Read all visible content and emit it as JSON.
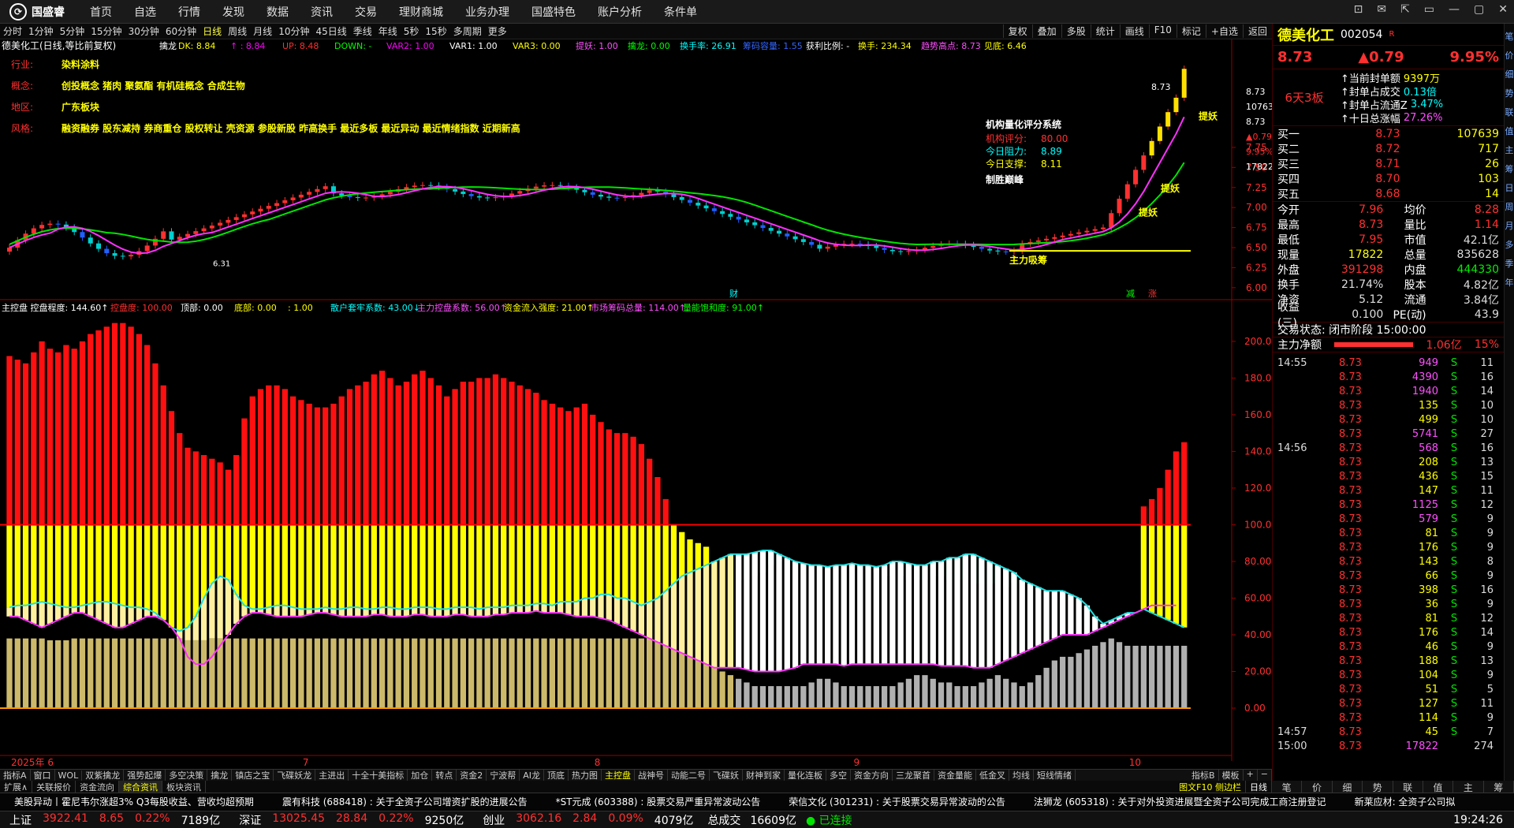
{
  "app": {
    "logo": "国盛睿",
    "menu": [
      "首页",
      "自选",
      "行情",
      "发现",
      "数据",
      "资讯",
      "交易",
      "理财商城",
      "业务办理",
      "国盛特色",
      "账户分析",
      "条件单"
    ],
    "window_controls": [
      "⊡",
      "✉",
      "⇱",
      "▭",
      "—",
      "▢",
      "✕"
    ]
  },
  "toolbar": {
    "periods": [
      "分时",
      "1分钟",
      "5分钟",
      "15分钟",
      "30分钟",
      "60分钟",
      "日线",
      "周线",
      "月线",
      "10分钟",
      "45日线",
      "季线",
      "年线",
      "5秒",
      "15秒",
      "多周期",
      "更多"
    ],
    "active_period": "日线",
    "right": [
      "复权",
      "叠加",
      "多股",
      "统计",
      "画线",
      "F10",
      "标记",
      "+自选",
      "返回"
    ]
  },
  "kline": {
    "title": "德美化工(日线,等比前复权)",
    "indicator_line": [
      {
        "t": "擒龙",
        "c": "#fff"
      },
      {
        "t": "DK: 8.84",
        "c": "#ff0"
      },
      {
        "t": "↑ : 8.84",
        "c": "#f0f"
      },
      {
        "t": "UP: 8.48",
        "c": "#ff3030"
      },
      {
        "t": "DOWN:  -",
        "c": "#0f0"
      },
      {
        "t": "VAR2: 1.00",
        "c": "#f0f"
      },
      {
        "t": "VAR1: 1.00",
        "c": "#fff"
      },
      {
        "t": "VAR3: 0.00",
        "c": "#ff0"
      },
      {
        "t": "提妖: 1.00",
        "c": "#ff50ff"
      },
      {
        "t": "擒龙: 0.00",
        "c": "#0f0"
      },
      {
        "t": "换手率: 26.91",
        "c": "#0ff"
      },
      {
        "t": "筹码容量: 1.55",
        "c": "#36f"
      },
      {
        "t": "获利比例:  -",
        "c": "#fff"
      },
      {
        "t": "换手: 234.34",
        "c": "#ff0"
      },
      {
        "t": "趋势高点: 8.73",
        "c": "#ff50ff"
      },
      {
        "t": "见底: 6.46",
        "c": "#ff0"
      }
    ],
    "info_rows": [
      {
        "label": "行业:",
        "value": "染料涂料"
      },
      {
        "label": "概念:",
        "value": "创投概念 猪肉 聚氨酯 有机硅概念 合成生物"
      },
      {
        "label": "地区:",
        "value": "广东板块"
      },
      {
        "label": "风格:",
        "value": "融资融券 股东减持 券商重仓 股权转让 壳资源 参股新股 昨高换手 最近多板 最近异动 最近情绪指数 近期新高"
      }
    ],
    "eval_box": {
      "title": "机构量化评分系统",
      "rows": [
        {
          "k": "机构评分:",
          "v": "80.00",
          "c": "#ff3030"
        },
        {
          "k": "今日阻力:",
          "v": "8.89",
          "c": "#0ff"
        },
        {
          "k": "今日支撑:",
          "v": "8.11",
          "c": "#ff0"
        }
      ],
      "footer": "制胜巅峰"
    },
    "labels": {
      "high": "8.73",
      "low": "6.31",
      "zljc": "主力吸筹",
      "ty1": "提妖",
      "ty2": "提妖",
      "ty3": "提妖",
      "cai": "财",
      "jian": "减",
      "zhang": "涨"
    },
    "right_axis_info": [
      "8.73",
      "107639",
      "8.73",
      "▲0.79",
      "9.95%",
      "17822"
    ],
    "y_ticks": [
      {
        "v": 7.75,
        "t": "7.75"
      },
      {
        "v": 7.5,
        "t": "7.50"
      },
      {
        "v": 7.25,
        "t": "7.25"
      },
      {
        "v": 7.0,
        "t": "7.00"
      },
      {
        "v": 6.75,
        "t": "6.75"
      },
      {
        "v": 6.5,
        "t": "6.50"
      },
      {
        "v": 6.25,
        "t": "6.25"
      },
      {
        "v": 6.0,
        "t": "6.00"
      }
    ]
  },
  "ind": {
    "title_line": [
      {
        "t": "主控盘  控盘程度: 144.60↑",
        "c": "#fff"
      },
      {
        "t": "控盘度: 100.00",
        "c": "#ff3030"
      },
      {
        "t": "顶部: 0.00",
        "c": "#fff"
      },
      {
        "t": "底部: 0.00",
        "c": "#ff0"
      },
      {
        "t": ": 1.00",
        "c": "#ff0"
      },
      {
        "t": "散户套牢系数: 43.00↓",
        "c": "#0ff"
      },
      {
        "t": "主力控盘系数: 56.00↑",
        "c": "#ff50ff"
      },
      {
        "t": "资金流入强度: 21.00↑",
        "c": "#ff0"
      },
      {
        "t": "市场筹码总量: 114.00↑",
        "c": "#ff50ff"
      },
      {
        "t": "量能饱和度: 91.00↑",
        "c": "#0f0"
      }
    ],
    "y_ticks": [
      {
        "v": 200,
        "t": "200.0"
      },
      {
        "v": 180,
        "t": "180.0"
      },
      {
        "v": 160,
        "t": "160.0"
      },
      {
        "v": 140,
        "t": "140.0"
      },
      {
        "v": 120,
        "t": "120.0"
      },
      {
        "v": 100,
        "t": "100.0"
      },
      {
        "v": 80,
        "t": "80.00"
      },
      {
        "v": 60,
        "t": "60.00"
      },
      {
        "v": 40,
        "t": "40.00"
      },
      {
        "v": 20,
        "t": "20.00"
      },
      {
        "v": 0,
        "t": "0.00"
      }
    ]
  },
  "chart_data": {
    "type": "bar",
    "title": "德美化工(日线,等比前复权)",
    "months": [
      {
        "idx": 0,
        "t": "2025年 6"
      },
      {
        "idx": 36,
        "t": "7"
      },
      {
        "idx": 72,
        "t": "8"
      },
      {
        "idx": 104,
        "t": "9"
      },
      {
        "idx": 138,
        "t": "10"
      }
    ],
    "control_degree": [
      192,
      190,
      188,
      194,
      200,
      196,
      194,
      198,
      196,
      200,
      204,
      206,
      208,
      210,
      210,
      208,
      204,
      198,
      188,
      176,
      162,
      150,
      142,
      140,
      138,
      136,
      134,
      130,
      138,
      158,
      170,
      174,
      176,
      176,
      174,
      170,
      168,
      166,
      164,
      164,
      166,
      170,
      174,
      176,
      178,
      182,
      184,
      180,
      176,
      178,
      182,
      184,
      180,
      176,
      170,
      174,
      178,
      178,
      180,
      180,
      182,
      180,
      178,
      176,
      174,
      172,
      168,
      166,
      164,
      162,
      164,
      166,
      160,
      156,
      152,
      150,
      150,
      148,
      144,
      136,
      126,
      114,
      100,
      96,
      92,
      90,
      88,
      80,
      76,
      72,
      70,
      70,
      72,
      74,
      78,
      80,
      82,
      84,
      84,
      84,
      82,
      80,
      80,
      80,
      78,
      76,
      76,
      74,
      72,
      72,
      72,
      70,
      70,
      70,
      72,
      72,
      70,
      70,
      70,
      68,
      68,
      68,
      68,
      66,
      68,
      68,
      66,
      64,
      66,
      64,
      64,
      62,
      62,
      60,
      60,
      60,
      70,
      80,
      90,
      100,
      110,
      114,
      120,
      130,
      140,
      145
    ],
    "cyan_line": [
      55,
      56,
      56,
      57,
      58,
      57,
      56,
      55,
      55,
      56,
      57,
      58,
      58,
      57,
      56,
      55,
      55,
      54,
      52,
      48,
      44,
      42,
      44,
      50,
      60,
      68,
      72,
      70,
      62,
      56,
      54,
      54,
      55,
      56,
      56,
      55,
      54,
      54,
      54,
      55,
      54,
      54,
      55,
      55,
      54,
      54,
      55,
      55,
      54,
      54,
      55,
      55,
      55,
      54,
      54,
      55,
      55,
      55,
      54,
      55,
      55,
      55,
      56,
      56,
      56,
      57,
      57,
      56,
      58,
      58,
      58,
      60,
      60,
      62,
      62,
      60,
      60,
      58,
      56,
      58,
      60,
      64,
      68,
      72,
      74,
      76,
      78,
      80,
      82,
      84,
      84,
      84,
      85,
      86,
      86,
      84,
      82,
      80,
      79,
      78,
      78,
      77,
      78,
      78,
      79,
      78,
      78,
      77,
      78,
      80,
      80,
      79,
      78,
      78,
      80,
      80,
      82,
      82,
      84,
      84,
      82,
      80,
      78,
      76,
      74,
      70,
      68,
      66,
      64,
      64,
      64,
      62,
      60,
      56,
      50,
      46,
      48,
      50,
      52,
      52,
      54,
      52,
      50,
      48,
      46,
      44
    ],
    "mag_line": [
      50,
      50,
      48,
      46,
      44,
      46,
      48,
      50,
      52,
      52,
      50,
      48,
      46,
      44,
      44,
      46,
      48,
      50,
      50,
      48,
      44,
      38,
      28,
      24,
      24,
      28,
      34,
      40,
      46,
      50,
      52,
      52,
      51,
      50,
      50,
      50,
      50,
      51,
      52,
      52,
      51,
      50,
      50,
      50,
      50,
      51,
      51,
      50,
      50,
      50,
      51,
      51,
      50,
      50,
      50,
      51,
      51,
      50,
      50,
      50,
      51,
      51,
      52,
      52,
      52,
      53,
      52,
      52,
      52,
      51,
      50,
      50,
      50,
      49,
      48,
      46,
      44,
      42,
      40,
      38,
      36,
      34,
      32,
      30,
      28,
      26,
      24,
      22,
      22,
      22,
      22,
      21,
      20,
      20,
      20,
      20,
      21,
      22,
      24,
      24,
      24,
      24,
      24,
      23,
      24,
      24,
      24,
      24,
      24,
      24,
      24,
      24,
      24,
      24,
      24,
      23,
      23,
      23,
      23,
      22,
      22,
      22,
      24,
      26,
      28,
      30,
      32,
      34,
      36,
      38,
      40,
      40,
      40,
      40,
      42,
      44,
      46,
      48,
      50,
      52,
      54,
      56,
      56,
      56,
      56
    ],
    "yel_bar_top": [
      38,
      38,
      38,
      38,
      38,
      37,
      37,
      37,
      38,
      38,
      38,
      38,
      38,
      38,
      38,
      38,
      38,
      38,
      38,
      38,
      38,
      38,
      37,
      37,
      37,
      38,
      38,
      38,
      38,
      38,
      38,
      38,
      38,
      38,
      38,
      38,
      38,
      38,
      38,
      38,
      38,
      38,
      38,
      38,
      38,
      38,
      38,
      38,
      38,
      38,
      38,
      38,
      38,
      38,
      38,
      38,
      38,
      38,
      38,
      38,
      38,
      38,
      38,
      38,
      38,
      38,
      38,
      38,
      38,
      38,
      38,
      38,
      38,
      38,
      38,
      38,
      38,
      38,
      38,
      38,
      36,
      34,
      32,
      30,
      28,
      26,
      24,
      22,
      20,
      18,
      16,
      14,
      12,
      12,
      12,
      12,
      12,
      12,
      12,
      14,
      16,
      16,
      14,
      12,
      12,
      12,
      12,
      12,
      12,
      12,
      14,
      16,
      18,
      18,
      16,
      14,
      14,
      12,
      12,
      12,
      14,
      16,
      18,
      16,
      14,
      12,
      14,
      18,
      22,
      26,
      28,
      28,
      30,
      32,
      34,
      36,
      38,
      36,
      34,
      34,
      34,
      34,
      34,
      34,
      34,
      34
    ]
  },
  "side": {
    "name": "德美化工",
    "code": "002054",
    "flag": "R",
    "price": "8.73",
    "change": "▲0.79",
    "pct": "9.95%",
    "board": "6天3板",
    "seal": [
      {
        "k": "当前封单额",
        "v": "9397万",
        "c": "#ff0"
      },
      {
        "k": "封单占成交",
        "v": "0.13倍",
        "c": "#0ff"
      },
      {
        "k": "封单占流通Z",
        "v": "3.47%",
        "c": "#0ff"
      },
      {
        "k": "十日总涨幅",
        "v": "27.26%",
        "c": "#ff50ff"
      }
    ],
    "sell": [
      {
        "k": "卖五",
        "p": "",
        "v": ""
      },
      {
        "k": "卖四",
        "p": "",
        "v": ""
      },
      {
        "k": "卖三",
        "p": "",
        "v": ""
      },
      {
        "k": "卖二",
        "p": "",
        "v": ""
      },
      {
        "k": "卖一",
        "p": "",
        "v": ""
      }
    ],
    "buy": [
      {
        "k": "买一",
        "p": "8.73",
        "v": "107639"
      },
      {
        "k": "买二",
        "p": "8.72",
        "v": "717"
      },
      {
        "k": "买三",
        "p": "8.71",
        "v": "26"
      },
      {
        "k": "买四",
        "p": "8.70",
        "v": "103"
      },
      {
        "k": "买五",
        "p": "8.68",
        "v": "14"
      }
    ],
    "stats": [
      {
        "k1": "今开",
        "v1": "7.96",
        "c1": "#ff3030",
        "k2": "均价",
        "v2": "8.28",
        "c2": "#ff3030"
      },
      {
        "k1": "最高",
        "v1": "8.73",
        "c1": "#ff3030",
        "k2": "量比",
        "v2": "1.14",
        "c2": "#ff3030"
      },
      {
        "k1": "最低",
        "v1": "7.95",
        "c1": "#ff3030",
        "k2": "市值",
        "v2": "42.1亿",
        "c2": "#ddd"
      },
      {
        "k1": "现量",
        "v1": "17822",
        "c1": "#ff0",
        "k2": "总量",
        "v2": "835628",
        "c2": "#ddd"
      },
      {
        "k1": "外盘",
        "v1": "391298",
        "c1": "#ff3030",
        "k2": "内盘",
        "v2": "444330",
        "c2": "#0e0"
      },
      {
        "k1": "换手",
        "v1": "21.74%",
        "c1": "#ddd",
        "k2": "股本",
        "v2": "4.82亿",
        "c2": "#ddd"
      },
      {
        "k1": "净资",
        "v1": "5.12",
        "c1": "#ddd",
        "k2": "流通",
        "v2": "3.84亿",
        "c2": "#ddd"
      },
      {
        "k1": "收益(三)",
        "v1": "0.100",
        "c1": "#ddd",
        "k2": "PE(动)",
        "v2": "43.9",
        "c2": "#ddd"
      }
    ],
    "trade_state": "交易状态: 闭市阶段 15:00:00",
    "net_inflow": {
      "label": "主力净额",
      "value": "1.06亿",
      "pct": "15%"
    },
    "ticks": [
      {
        "t": "14:55",
        "p": "8.73",
        "v": "949",
        "vc": "#ff50ff",
        "s": "S",
        "n": "11"
      },
      {
        "t": "",
        "p": "8.73",
        "v": "4390",
        "vc": "#ff50ff",
        "s": "S",
        "n": "16"
      },
      {
        "t": "",
        "p": "8.73",
        "v": "1940",
        "vc": "#ff50ff",
        "s": "S",
        "n": "14"
      },
      {
        "t": "",
        "p": "8.73",
        "v": "135",
        "vc": "#ff0",
        "s": "S",
        "n": "10"
      },
      {
        "t": "",
        "p": "8.73",
        "v": "499",
        "vc": "#ff0",
        "s": "S",
        "n": "10"
      },
      {
        "t": "",
        "p": "8.73",
        "v": "5741",
        "vc": "#ff50ff",
        "s": "S",
        "n": "27"
      },
      {
        "t": "14:56",
        "p": "8.73",
        "v": "568",
        "vc": "#ff50ff",
        "s": "S",
        "n": "16"
      },
      {
        "t": "",
        "p": "8.73",
        "v": "208",
        "vc": "#ff0",
        "s": "S",
        "n": "13"
      },
      {
        "t": "",
        "p": "8.73",
        "v": "436",
        "vc": "#ff0",
        "s": "S",
        "n": "15"
      },
      {
        "t": "",
        "p": "8.73",
        "v": "147",
        "vc": "#ff0",
        "s": "S",
        "n": "11"
      },
      {
        "t": "",
        "p": "8.73",
        "v": "1125",
        "vc": "#ff50ff",
        "s": "S",
        "n": "12"
      },
      {
        "t": "",
        "p": "8.73",
        "v": "579",
        "vc": "#ff50ff",
        "s": "S",
        "n": "9"
      },
      {
        "t": "",
        "p": "8.73",
        "v": "81",
        "vc": "#ff0",
        "s": "S",
        "n": "9"
      },
      {
        "t": "",
        "p": "8.73",
        "v": "176",
        "vc": "#ff0",
        "s": "S",
        "n": "9"
      },
      {
        "t": "",
        "p": "8.73",
        "v": "143",
        "vc": "#ff0",
        "s": "S",
        "n": "8"
      },
      {
        "t": "",
        "p": "8.73",
        "v": "66",
        "vc": "#ff0",
        "s": "S",
        "n": "9"
      },
      {
        "t": "",
        "p": "8.73",
        "v": "398",
        "vc": "#ff0",
        "s": "S",
        "n": "16"
      },
      {
        "t": "",
        "p": "8.73",
        "v": "36",
        "vc": "#ff0",
        "s": "S",
        "n": "9"
      },
      {
        "t": "",
        "p": "8.73",
        "v": "81",
        "vc": "#ff0",
        "s": "S",
        "n": "12"
      },
      {
        "t": "",
        "p": "8.73",
        "v": "176",
        "vc": "#ff0",
        "s": "S",
        "n": "14"
      },
      {
        "t": "",
        "p": "8.73",
        "v": "46",
        "vc": "#ff0",
        "s": "S",
        "n": "9"
      },
      {
        "t": "",
        "p": "8.73",
        "v": "188",
        "vc": "#ff0",
        "s": "S",
        "n": "13"
      },
      {
        "t": "",
        "p": "8.73",
        "v": "104",
        "vc": "#ff0",
        "s": "S",
        "n": "9"
      },
      {
        "t": "",
        "p": "8.73",
        "v": "51",
        "vc": "#ff0",
        "s": "S",
        "n": "5"
      },
      {
        "t": "",
        "p": "8.73",
        "v": "127",
        "vc": "#ff0",
        "s": "S",
        "n": "11"
      },
      {
        "t": "",
        "p": "8.73",
        "v": "114",
        "vc": "#ff0",
        "s": "S",
        "n": "9"
      },
      {
        "t": "14:57",
        "p": "8.73",
        "v": "45",
        "vc": "#ff0",
        "s": "S",
        "n": "7"
      },
      {
        "t": "15:00",
        "p": "8.73",
        "v": "17822",
        "vc": "#ff50ff",
        "s": "",
        "n": "274"
      }
    ],
    "vstrip": [
      "笔",
      "价",
      "细",
      "势",
      "联",
      "值",
      "主",
      "筹",
      "日",
      "周",
      "月",
      "多",
      "季",
      "年"
    ],
    "bottom_tabs": [
      "笔",
      "价",
      "细",
      "势",
      "联",
      "值",
      "主",
      "筹"
    ]
  },
  "bottom_tabs": [
    "指标A",
    "窗口",
    "WOL",
    "双紫擒龙",
    "强势起爆",
    "多空决策",
    "擒龙",
    "镇店之宝",
    "飞碟妖龙",
    "主进出",
    "十全十美指标",
    "加仓",
    "转点",
    "资金2",
    "宁波帮",
    "AI龙",
    "顶底",
    "热力图",
    "主控盘",
    "战神号",
    "动能二号",
    "飞碟妖",
    "财神到家",
    "量化连板",
    "多空",
    "资金方向",
    "三龙聚首",
    "资金量能",
    "低金叉",
    "均线",
    "短线情绪"
  ],
  "bottom_active": "主控盘",
  "bottom_right": [
    "指标B",
    "模板",
    "+",
    "−"
  ],
  "info_tabs": [
    "扩展∧",
    "关联报价",
    "资金流向",
    "综合资讯",
    "板块资讯"
  ],
  "info_active": "综合资讯",
  "info_right": "图文F10 侧边栏",
  "day_label": "日线",
  "news": [
    "美股异动丨霍尼韦尔涨超3% Q3每股收益、营收均超预期",
    "震有科技 (688418) : 关于全资子公司增资扩股的进展公告",
    "*ST元成 (603388) : 股票交易严重异常波动公告",
    "荣信文化 (301231) : 关于股票交易异常波动的公告",
    "法狮龙 (605318) : 关于对外投资进展暨全资子公司完成工商注册登记",
    "新莱应材: 全资子公司拟"
  ],
  "status": {
    "items": [
      {
        "k": "上证",
        "v": "3922.41",
        "c": "8.65",
        "p": "0.22%",
        "a": "7189亿"
      },
      {
        "k": "深证",
        "v": "13025.45",
        "c": "28.84",
        "p": "0.22%",
        "a": "9250亿"
      },
      {
        "k": "创业",
        "v": "3062.16",
        "c": "2.84",
        "p": "0.09%",
        "a": "4079亿"
      }
    ],
    "total_label": "总成交",
    "total": "16609亿",
    "conn": "已连接",
    "time": "19:24:26"
  }
}
